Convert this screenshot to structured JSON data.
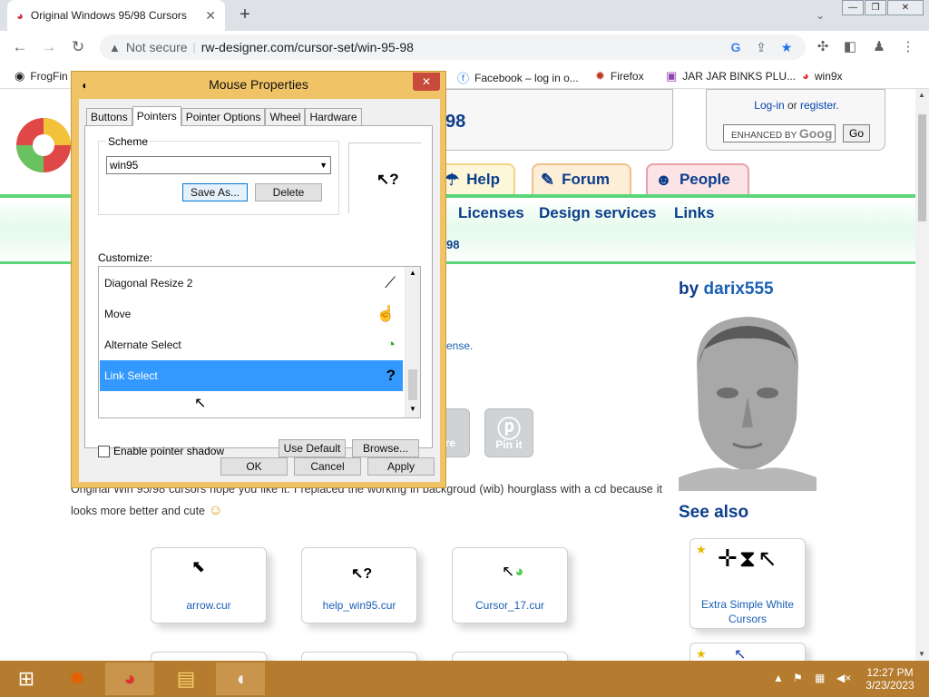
{
  "browser": {
    "tab_title": "Original Windows 95/98 Cursors",
    "tab_close": "✕",
    "new_tab": "+",
    "tab_search": "⌄",
    "window_buttons": [
      "—",
      "❐",
      "✕"
    ],
    "security_label": "Not secure",
    "url": "rw-designer.com/cursor-set/win-95-98",
    "bookmarks": [
      {
        "label": "FrogFin",
        "icon": "globe-icon"
      },
      {
        "label": "Facebook – log in o...",
        "icon": "facebook-icon"
      },
      {
        "label": "Firefox",
        "icon": "firefox-icon"
      },
      {
        "label": "JAR JAR BINKS PLU...",
        "icon": "bag-icon"
      },
      {
        "label": "win9x",
        "icon": "chrome-icon"
      }
    ]
  },
  "site": {
    "header_fragment": "98",
    "login_text": "Log-in",
    "or_text": "or",
    "register_text": "register.",
    "search_placeholder": "ENHANCED BY",
    "search_brand": "Goog",
    "go_label": "Go",
    "nav_tabs": [
      "Help",
      "Forum",
      "People"
    ],
    "main_links": [
      "Licenses",
      "Design services",
      "Links"
    ],
    "fragment_98": "98",
    "license_fragment": "ense.",
    "by_label": "by",
    "author": "darix555",
    "share_label": "are",
    "pin_label": "Pin it",
    "description": "Original Win 95/98 cursors hope you like it. I replaced the working in backgroud (wib) hourglass with a cd because it looks more better and cute",
    "see_also": "See also",
    "cursor_files": [
      "arrow.cur",
      "help_win95.cur",
      "Cursor_17.cur"
    ],
    "see_also_items": [
      "Extra Simple White Cursors"
    ]
  },
  "dialog": {
    "title": "Mouse Properties",
    "close_label": "✕",
    "tabs": [
      "Buttons",
      "Pointers",
      "Pointer Options",
      "Wheel",
      "Hardware"
    ],
    "active_tab": "Pointers",
    "scheme_label": "Scheme",
    "scheme_value": "win95",
    "save_as": "Save As...",
    "delete": "Delete",
    "customize_label": "Customize:",
    "pointer_items": [
      {
        "label": "Diagonal Resize 2",
        "icon": "diagonal-resize-icon",
        "glyph": "⟋"
      },
      {
        "label": "Move",
        "icon": "hand-pointer-icon",
        "glyph": "☝"
      },
      {
        "label": "Alternate Select",
        "icon": "cd-cursor-icon",
        "glyph": "◔"
      },
      {
        "label": "Link Select",
        "icon": "help-cursor-icon",
        "glyph": "?",
        "selected": true
      }
    ],
    "enable_shadow": "Enable pointer shadow",
    "use_default": "Use Default",
    "browse": "Browse...",
    "ok": "OK",
    "cancel": "Cancel",
    "apply": "Apply"
  },
  "taskbar": {
    "apps": [
      "start-icon",
      "firefox-icon",
      "chrome-icon",
      "file-explorer-icon",
      "mouse-icon"
    ],
    "time": "12:27 PM",
    "date": "3/23/2023"
  },
  "colors": {
    "taskbar": "#b57b2e",
    "dialog_frame": "#f0c466",
    "selection": "#3399ff",
    "link": "#0b3e8a"
  }
}
